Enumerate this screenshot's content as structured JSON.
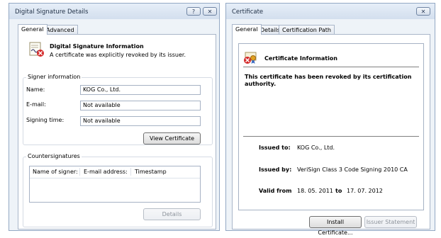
{
  "left_window": {
    "title": "Digital Signature Details",
    "help_button": "?",
    "close_button": "✕",
    "tabs": [
      "General",
      "Advanced"
    ],
    "info": {
      "heading": "Digital Signature Information",
      "description": "A certificate was explicitly revoked by its issuer."
    },
    "signer": {
      "group_label": "Signer information",
      "name_label": "Name:",
      "name_value": "KOG Co., Ltd.",
      "email_label": "E-mail:",
      "email_value": "Not available",
      "time_label": "Signing time:",
      "time_value": "Not available",
      "view_button": "View Certificate"
    },
    "countersignatures": {
      "group_label": "Countersignatures",
      "columns": [
        "Name of signer:",
        "E-mail address:",
        "Timestamp"
      ],
      "details_button": "Details"
    }
  },
  "right_window": {
    "title": "Certificate",
    "close_button": "✕",
    "tabs": [
      "General",
      "Details",
      "Certification Path"
    ],
    "info_heading": "Certificate Information",
    "revoked_message": "This certificate has been revoked by its certification authority.",
    "issued_to_label": "Issued to:",
    "issued_to_value": "KOG Co., Ltd.",
    "issued_by_label": "Issued by:",
    "issued_by_value": "VeriSign Class 3 Code Signing 2010 CA",
    "valid_from_label": "Valid from",
    "valid_from_value": "18. 05. 2011",
    "valid_to_label": "to",
    "valid_to_value": "17. 07. 2012",
    "install_button": "Install Certificate...",
    "issuer_statement_button": "Issuer Statement"
  }
}
